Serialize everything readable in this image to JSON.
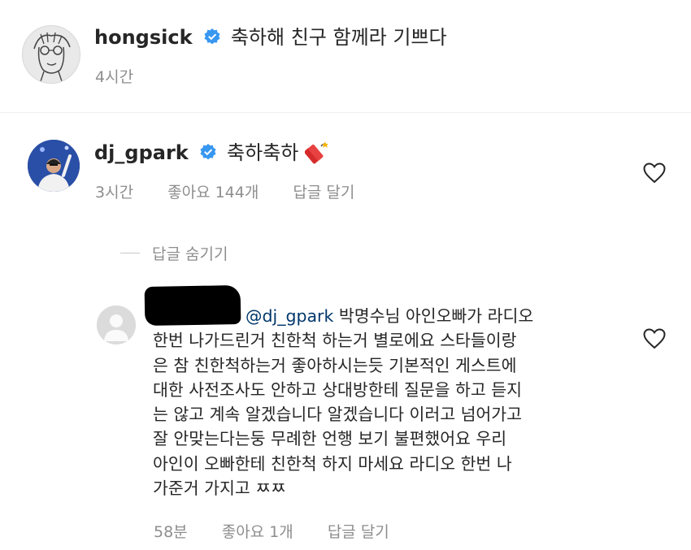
{
  "comments": [
    {
      "username": "hongsick",
      "text": "축하해 친구 함께라 기쁘다",
      "time": "4시간"
    },
    {
      "username": "dj_gpark",
      "text": "축하축하",
      "time": "3시간",
      "likes": "좋아요 144개",
      "reply": "답글 달기",
      "emoji": "firecracker-icon"
    }
  ],
  "hide_replies": "답글 숨기기",
  "reply_comment": {
    "mention": "@dj_gpark",
    "lines": [
      "박명수님 아인오빠가 라디오",
      "한번 나가드린거 친한척 하는거 별로에요 스타들이랑",
      "은 참 친한척하는거 좋아하시는듯 기본적인 게스트에",
      "대한 사전조사도 안하고 상대방한테 질문을 하고 듣지",
      "는 않고 계속 알겠습니다 알겠습니다 이러고 넘어가고",
      "잘 안맞는다는둥 무례한 언행 보기 불편했어요 우리",
      "아인이 오빠한테 친한척 하지 마세요 라디오 한번 나",
      "가준거 가지고 ㅉㅉ"
    ],
    "time": "58분",
    "likes": "좋아요 1개",
    "reply": "답글 달기"
  },
  "colors": {
    "text": "#262626",
    "meta": "#8e8e8e",
    "verified": "#3897f0",
    "mention": "#00376b",
    "redaction": "#000000"
  }
}
